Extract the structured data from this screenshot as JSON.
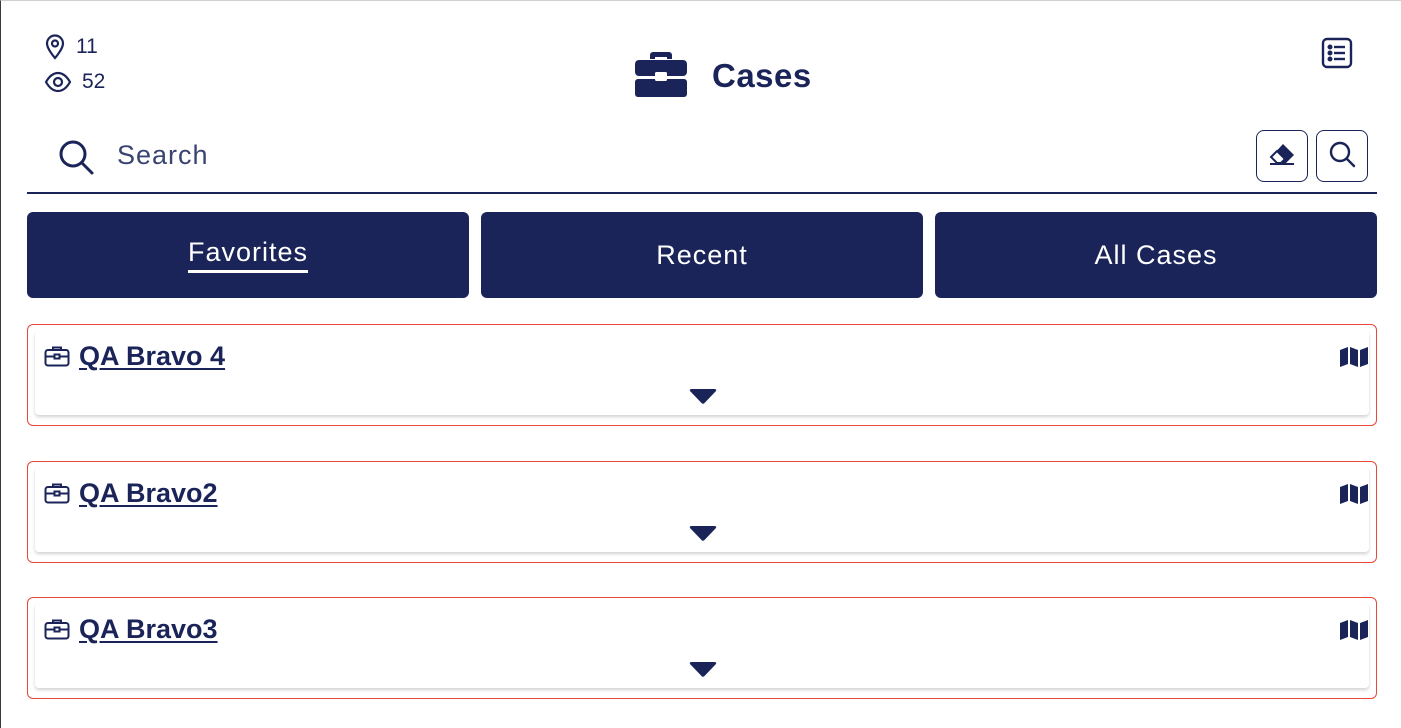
{
  "header": {
    "location_count": "11",
    "view_count": "52",
    "title": "Cases",
    "title_icon": "briefcase-icon",
    "list_icon": "list-view-icon"
  },
  "search": {
    "placeholder": "Search",
    "value": "",
    "clear_icon": "eraser-icon",
    "submit_icon": "search-icon"
  },
  "tabs": [
    {
      "label": "Favorites",
      "active": true
    },
    {
      "label": "Recent",
      "active": false
    },
    {
      "label": "All Cases",
      "active": false
    }
  ],
  "cases": [
    {
      "name": "QA Bravo 4",
      "icon": "briefcase-icon",
      "action_icon": "map-icon",
      "expand_icon": "caret-down-icon"
    },
    {
      "name": "QA Bravo2",
      "icon": "briefcase-icon",
      "action_icon": "map-icon",
      "expand_icon": "caret-down-icon"
    },
    {
      "name": "QA Bravo3",
      "icon": "briefcase-icon",
      "action_icon": "map-icon",
      "expand_icon": "caret-down-icon"
    }
  ],
  "colors": {
    "primary": "#1b2459",
    "card_border": "#e8473a",
    "background": "#ffffff"
  }
}
